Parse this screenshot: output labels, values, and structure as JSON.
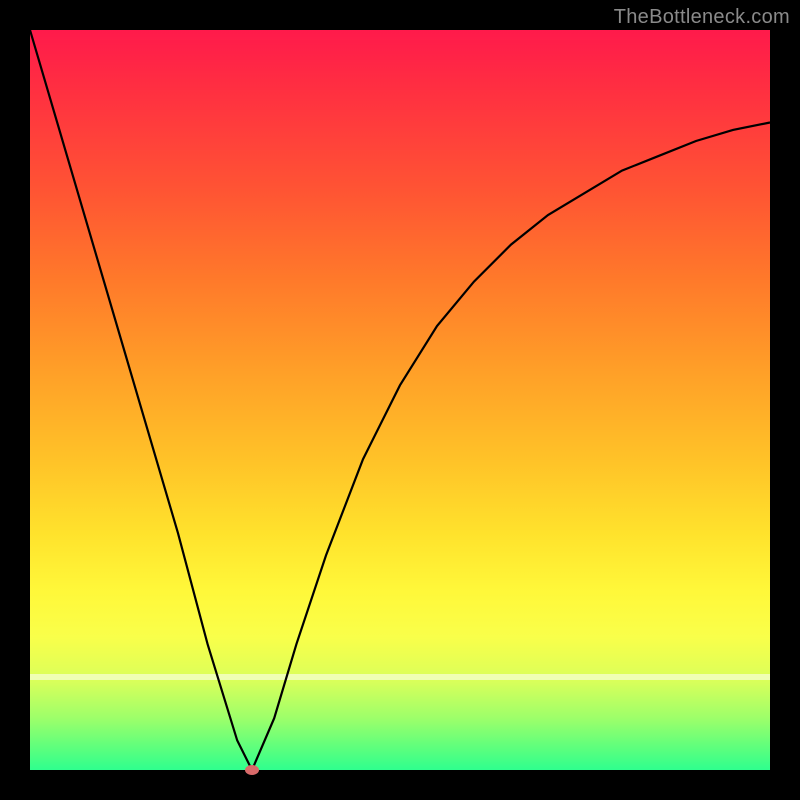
{
  "watermark": "TheBottleneck.com",
  "colors": {
    "frame": "#000000",
    "curve": "#000000",
    "marker": "#d96a6a"
  },
  "chart_data": {
    "type": "line",
    "title": "",
    "xlabel": "",
    "ylabel": "",
    "xlim": [
      0,
      100
    ],
    "ylim": [
      0,
      100
    ],
    "grid": false,
    "legend": false,
    "series": [
      {
        "name": "bottleneck-curve",
        "x": [
          0,
          5,
          10,
          15,
          20,
          24,
          28,
          30,
          33,
          36,
          40,
          45,
          50,
          55,
          60,
          65,
          70,
          75,
          80,
          85,
          90,
          95,
          100
        ],
        "y": [
          100,
          83,
          66,
          49,
          32,
          17,
          4,
          0,
          7,
          17,
          29,
          42,
          52,
          60,
          66,
          71,
          75,
          78,
          81,
          83,
          85,
          86.5,
          87.5
        ]
      }
    ],
    "marker": {
      "x": 30,
      "y": 0
    },
    "gradient_stops": [
      {
        "pos": 0.0,
        "color": "#ff1a4b"
      },
      {
        "pos": 0.08,
        "color": "#ff2f41"
      },
      {
        "pos": 0.22,
        "color": "#ff5533"
      },
      {
        "pos": 0.34,
        "color": "#ff7a2a"
      },
      {
        "pos": 0.46,
        "color": "#ff9f28"
      },
      {
        "pos": 0.58,
        "color": "#ffc228"
      },
      {
        "pos": 0.68,
        "color": "#ffe22c"
      },
      {
        "pos": 0.76,
        "color": "#fff83a"
      },
      {
        "pos": 0.82,
        "color": "#f9ff4a"
      },
      {
        "pos": 0.88,
        "color": "#d9ff5a"
      },
      {
        "pos": 0.93,
        "color": "#9dff6a"
      },
      {
        "pos": 0.97,
        "color": "#5dff7d"
      },
      {
        "pos": 1.0,
        "color": "#2fff8e"
      }
    ]
  }
}
